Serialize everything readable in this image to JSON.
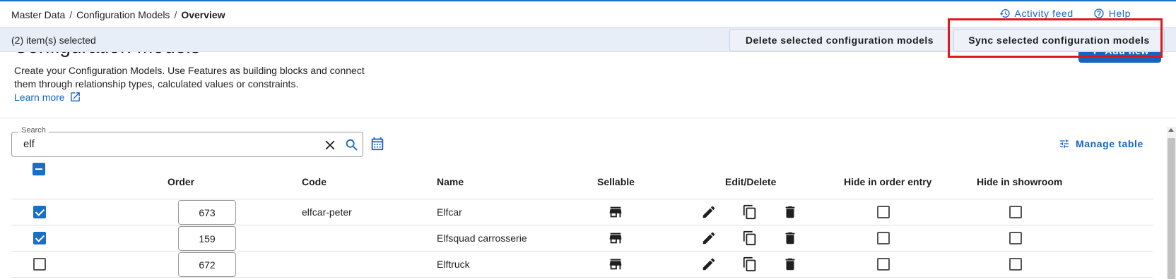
{
  "breadcrumb": {
    "items": [
      "Master Data",
      "Configuration Models"
    ],
    "separator": "/",
    "current": "Overview"
  },
  "header_links": {
    "activity": "Activity feed",
    "help": "Help"
  },
  "page": {
    "title": "Configuration Models",
    "description": "Create your Configuration Models. Use Features as building blocks and connect them through relationship types, calculated values or constraints.",
    "learn_more": "Learn more",
    "add_new": "Add new"
  },
  "selection_bar": {
    "count_text": "(2) item(s) selected",
    "delete_label": "Delete selected configuration models",
    "sync_label": "Sync selected configuration models"
  },
  "search": {
    "label": "Search",
    "value": "elf"
  },
  "manage_table": "Manage table",
  "table": {
    "columns": [
      "Order",
      "Code",
      "Name",
      "Sellable",
      "Edit/Delete",
      "Hide in order entry",
      "Hide in showroom"
    ],
    "rows": [
      {
        "selected": true,
        "order": "673",
        "code": "elfcar-peter",
        "name": "Elfcar",
        "hide_order_entry": false,
        "hide_showroom": false
      },
      {
        "selected": true,
        "order": "159",
        "code": "",
        "name": "Elfsquad carrosserie",
        "hide_order_entry": false,
        "hide_showroom": false
      },
      {
        "selected": false,
        "order": "672",
        "code": "",
        "name": "Elftruck",
        "hide_order_entry": false,
        "hide_showroom": false
      }
    ]
  },
  "colors": {
    "accent": "#1565c0",
    "selection_bar_bg": "#e8eef8",
    "highlight": "#e0161e"
  }
}
